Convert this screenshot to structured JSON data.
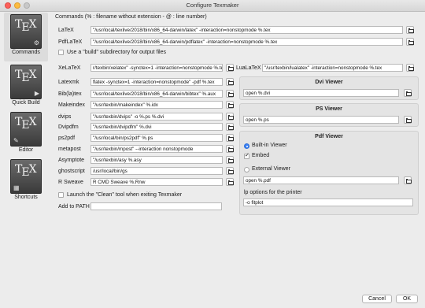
{
  "window": {
    "title": "Configure Texmaker"
  },
  "sidebar": {
    "items": [
      {
        "label": "Commands",
        "active": true,
        "badge_icon": "gear-icon"
      },
      {
        "label": "Quick Build",
        "active": false,
        "badge_icon": "play-icon"
      },
      {
        "label": "Editor",
        "active": false,
        "badge_icon": "pencil-icon"
      },
      {
        "label": "Shortcuts",
        "active": false,
        "badge_icon": "keyboard-icon"
      }
    ],
    "icon_text_t": "T",
    "icon_text_e": "E",
    "icon_text_x": "X"
  },
  "header": "Commands (% : filename without extension - @ : line number)",
  "commands": {
    "latex": {
      "label": "LaTeX",
      "value": "\"/usr/local/texlive/2018/bin/x86_64-darwin/latex\" -interaction=nonstopmode %.tex"
    },
    "pdflatex": {
      "label": "PdfLaTeX",
      "value": "\"/usr/local/texlive/2018/bin/x86_64-darwin/pdflatex\" -interaction=nonstopmode %.tex"
    },
    "build_subdir": {
      "label": "Use a \"build\" subdirectory for output files",
      "checked": false
    },
    "xelatex": {
      "label": "XeLaTeX",
      "value": "r/texbin/xelatex\" -synctex=1 -interaction=nonstopmode %.tex"
    },
    "lualatex": {
      "label": "LuaLaTeX",
      "value": "\"/usr/texbin/lualatex\" -interaction=nonstopmode %.tex"
    },
    "latexmk": {
      "label": "Latexmk",
      "value": "flatex -synctex=1 -interaction=nonstopmode\" -pdf %.tex"
    },
    "bibtex": {
      "label": "Bib(la)tex",
      "value": "\"/usr/local/texlive/2018/bin/x86_64-darwin/bibtex\" %.aux"
    },
    "makeindex": {
      "label": "Makeindex",
      "value": "\"/usr/texbin/makeindex\" %.idx"
    },
    "dvips": {
      "label": "dvips",
      "value": "\"/usr/texbin/dvips\" -o %.ps %.dvi"
    },
    "dvipdfm": {
      "label": "Dvipdfm",
      "value": "\"/usr/texbin/dvipdfm\" %.dvi"
    },
    "ps2pdf": {
      "label": "ps2pdf",
      "value": "\"/usr/local/bin/ps2pdf\" %.ps"
    },
    "metapost": {
      "label": "metapost",
      "value": "\"/usr/texbin/mpost\" --interaction nonstopmode"
    },
    "asymptote": {
      "label": "Asymptote",
      "value": "\"/usr/texbin/asy %.asy"
    },
    "ghostscript": {
      "label": "ghostscript",
      "value": "/usr/local/bin/gs"
    },
    "rsweave": {
      "label": "R Sweave",
      "value": "R CMD Sweave %.Rnw"
    },
    "launch_clean": {
      "label": "Launch the \"Clean\" tool when exiting Texmaker",
      "checked": false
    },
    "add_to_path": {
      "label": "Add to PATH",
      "value": ""
    }
  },
  "dvi_viewer": {
    "title": "Dvi Viewer",
    "value": "open %.dvi"
  },
  "ps_viewer": {
    "title": "PS Viewer",
    "value": "open %.ps"
  },
  "pdf_viewer": {
    "title": "Pdf Viewer",
    "builtin": {
      "label": "Built-in Viewer",
      "selected": true
    },
    "embed": {
      "label": "Embed",
      "checked": true
    },
    "external": {
      "label": "External Viewer",
      "selected": false
    },
    "value": "open %.pdf",
    "lp_label": "lp options for the printer",
    "lp_value": "-o fitplot"
  },
  "footer": {
    "cancel": "Cancel",
    "ok": "OK"
  }
}
